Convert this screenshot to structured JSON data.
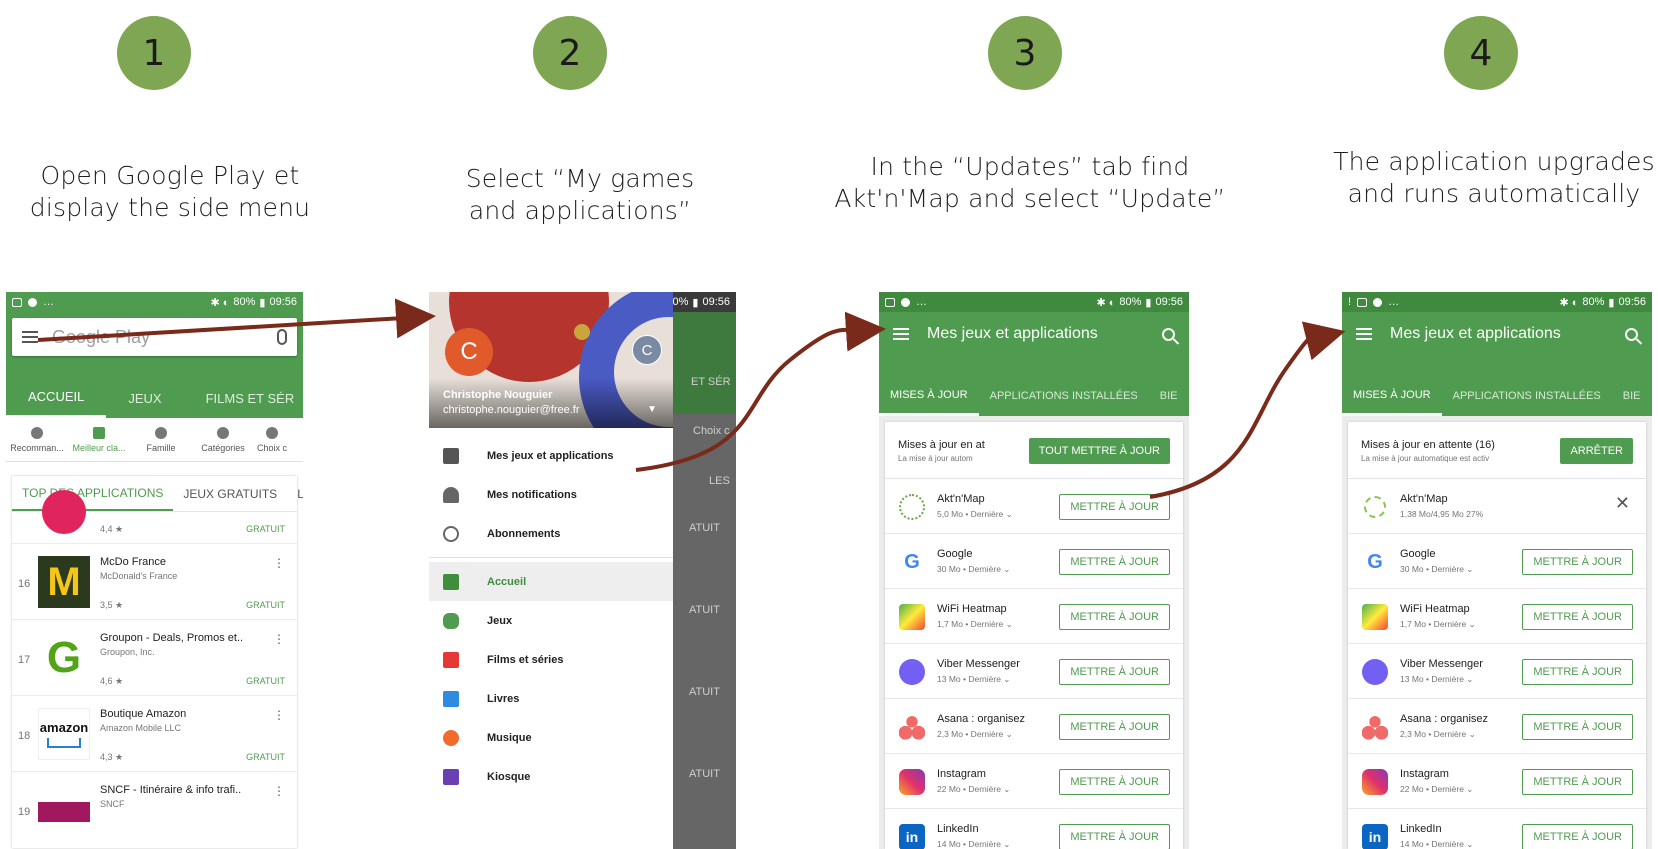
{
  "steps": [
    {
      "number": "1",
      "text_line1": "Open Google Play et",
      "text_line2": "display the side menu"
    },
    {
      "number": "2",
      "text_line1": "Select “My games",
      "text_line2": "and applications”"
    },
    {
      "number": "3",
      "text_line1": "In the “Updates” tab find",
      "text_line2": "Akt'n'Map and select “Update”"
    },
    {
      "number": "4",
      "text_line1": "The application upgrades",
      "text_line2": "and runs automatically"
    }
  ],
  "status": {
    "battery": "80%",
    "time": "09:56"
  },
  "phone1": {
    "search_placeholder": "Google Play",
    "tabs": [
      "ACCUEIL",
      "JEUX",
      "FILMS ET SÉR"
    ],
    "categories": [
      "Recomman...",
      "Meilleur cla...",
      "Famille",
      "Catégories",
      "Choix c"
    ],
    "subtabs": [
      "TOP DES APPLICATIONS",
      "JEUX GRATUITS",
      "LES"
    ],
    "rows": [
      {
        "rank": "",
        "name": "",
        "dev": "",
        "rating": "4,4 ★",
        "price": "GRATUIT",
        "icon": "app-icon-pink"
      },
      {
        "rank": "16",
        "name": "McDo France",
        "dev": "McDonald's France",
        "rating": "3,5 ★",
        "price": "GRATUIT",
        "icon": "mcdonalds-icon"
      },
      {
        "rank": "17",
        "name": "Groupon - Deals, Promos et..",
        "dev": "Groupon, Inc.",
        "rating": "4,6 ★",
        "price": "GRATUIT",
        "icon": "groupon-icon"
      },
      {
        "rank": "18",
        "name": "Boutique Amazon",
        "dev": "Amazon Mobile LLC",
        "rating": "4,3 ★",
        "price": "GRATUIT",
        "icon": "amazon-icon"
      },
      {
        "rank": "19",
        "name": "SNCF - Itinéraire & info trafi..",
        "dev": "SNCF",
        "rating": "",
        "price": "",
        "icon": "sncf-icon"
      }
    ],
    "amazon_logo": "amazon",
    "mcd_logo": "M",
    "groupon_logo": "G"
  },
  "phone2": {
    "avatar_letter": "C",
    "avatar2_letter": "C",
    "user_name": "Christophe Nouguier",
    "user_email": "christophe.nouguier@free.fr",
    "menu_top": [
      "Mes jeux et applications",
      "Mes notifications",
      "Abonnements"
    ],
    "menu_main": [
      "Accueil",
      "Jeux",
      "Films et séries",
      "Livres",
      "Musique",
      "Kiosque"
    ],
    "bg_texts": [
      "ET SÉR",
      "Choix c",
      "LES",
      "ATUIT",
      "ATUIT",
      "ATUIT",
      "ATUIT"
    ]
  },
  "phone3": {
    "title": "Mes jeux et applications",
    "tabs": [
      "MISES À JOUR",
      "APPLICATIONS INSTALLÉES",
      "BIE"
    ],
    "header_line1": "Mises à jour en at",
    "header_line2": "La mise à jour autom",
    "header_button": "TOUT METTRE À JOUR",
    "rows": [
      {
        "name": "Akt'n'Map",
        "meta": "5,0 Mo • Dernière ⌄",
        "button": "METTRE À JOUR"
      },
      {
        "name": "Google",
        "meta": "30 Mo • Dernière ⌄",
        "button": "METTRE À JOUR"
      },
      {
        "name": "WiFi Heatmap",
        "meta": "1,7 Mo • Dernière ⌄",
        "button": "METTRE À JOUR"
      },
      {
        "name": "Viber Messenger",
        "meta": "13 Mo • Dernière ⌄",
        "button": "METTRE À JOUR"
      },
      {
        "name": "Asana : organisez",
        "meta": "2,3 Mo • Dernière ⌄",
        "button": "METTRE À JOUR"
      },
      {
        "name": "Instagram",
        "meta": "22 Mo • Dernière ⌄",
        "button": "METTRE À JOUR"
      },
      {
        "name": "LinkedIn",
        "meta": "14 Mo • Dernière ⌄",
        "button": "METTRE À JOUR"
      }
    ]
  },
  "phone4": {
    "title": "Mes jeux et applications",
    "tabs": [
      "MISES À JOUR",
      "APPLICATIONS INSTALLÉES",
      "BIE"
    ],
    "header_line1": "Mises à jour en attente (16)",
    "header_line2": "La mise à jour automatique est activ",
    "header_button": "ARRÊTER",
    "downloading": {
      "name": "Akt'n'Map",
      "meta": "1,38 Mo/4,95 Mo   27%",
      "progress": 0.27,
      "close": "✕"
    },
    "rows": [
      {
        "name": "Google",
        "meta": "30 Mo • Dernière ⌄",
        "button": "METTRE À JOUR"
      },
      {
        "name": "WiFi Heatmap",
        "meta": "1,7 Mo • Dernière ⌄",
        "button": "METTRE À JOUR"
      },
      {
        "name": "Viber Messenger",
        "meta": "13 Mo • Dernière ⌄",
        "button": "METTRE À JOUR"
      },
      {
        "name": "Asana : organisez",
        "meta": "2,3 Mo • Dernière ⌄",
        "button": "METTRE À JOUR"
      },
      {
        "name": "Instagram",
        "meta": "22 Mo • Dernière ⌄",
        "button": "METTRE À JOUR"
      },
      {
        "name": "LinkedIn",
        "meta": "14 Mo • Dernière ⌄",
        "button": "METTRE À JOUR"
      }
    ]
  },
  "colors": {
    "play_green": "#4f9b4f",
    "step_circle": "#7ea653",
    "arrow": "#7a2a1a"
  }
}
